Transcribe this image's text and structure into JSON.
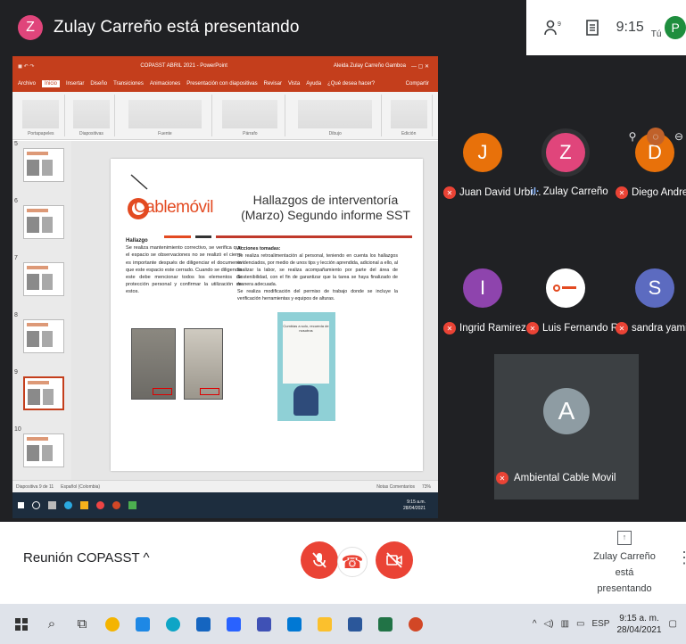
{
  "presenter": {
    "initial": "Z",
    "title": "Zulay Carreño está presentando"
  },
  "topright": {
    "time": "9:15",
    "you_label": "Tú",
    "user_initial": "P",
    "people_icon_count": "9"
  },
  "presentation": {
    "window_title": "COPASST ABRIL 2021 - PowerPoint",
    "window_user": "Aleida Zulay Carreño Gamboa",
    "ribbon_tabs": [
      "Archivo",
      "Inicio",
      "Insertar",
      "Diseño",
      "Transiciones",
      "Animaciones",
      "Presentación con diapositivas",
      "Revisar",
      "Vista",
      "Ayuda",
      "¿Qué desea hacer?"
    ],
    "ribbon_share": "Compartir",
    "ribbon_groups": [
      "Portapapeles",
      "Diapositivas",
      "Fuente",
      "Párrafo",
      "Dibujo",
      "Edición"
    ],
    "thumb_numbers": [
      "5",
      "6",
      "7",
      "8",
      "9",
      "10"
    ],
    "slide": {
      "logo": "Cablemóvil",
      "title": "Hallazgos de interventoría (Marzo) Segundo informe SST",
      "hallazgo_heading": "Hallazgo",
      "hallazgo_text": "Se realiza mantenimiento correctivo, se verifica que el espacio se observaciones no se realizó el cierre es importante después de diligenciar el documento que este espacio este cerrado. Cuando se diligencia este debe mencionar todos los elementos de protección personal y confirmar la utilización de estos.",
      "acciones_heading": "Acciones tomadas:",
      "acciones_text": "Se realiza retroalimentación al personal, teniendo en cuenta los hallazgos evidenciados, por medio de unos tips y lección aprendida, adicional a ello, al finalizar la labor, se realiza acompañamiento por parte del área de Sostenibilidad, con el fin de garantizar que la tarea se haya finalizado de manera adecuada.",
      "acciones_text2": "Se realiza modificación del permiso de trabajo donde se incluye la verificación herramientas y equipos de alturas.",
      "poster_title": "Cumbias a solo, recuerda de nosotros"
    },
    "status_left": "Diapositiva 9 de 11",
    "status_lang": "Español (Colombia)",
    "status_right": "Notas   Comentarios",
    "zoom": "73%",
    "inner_clock_time": "9:15 a.m.",
    "inner_clock_date": "28/04/2021"
  },
  "participants": [
    {
      "name": "Juan David Urbi...",
      "initial": "J",
      "color": "#e8710a",
      "muted": true
    },
    {
      "name": "Zulay Carreño",
      "initial": "Z",
      "color": "#e0457b",
      "muted": false
    },
    {
      "name": "Diego Andres A...",
      "initial": "D",
      "color": "#e8710a",
      "muted": true
    },
    {
      "name": "Ingrid Ramirez",
      "initial": "I",
      "color": "#8e44ad",
      "muted": true
    },
    {
      "name": "Luis Fernando R...",
      "initial": "",
      "color": "#ffffff",
      "muted": true
    },
    {
      "name": "sandra yamile c...",
      "initial": "S",
      "color": "#5c6bc0",
      "muted": true
    }
  ],
  "main_tile": {
    "name": "Ambiental Cable Movil",
    "initial": "A"
  },
  "bottom": {
    "meeting_name": "Reunión COPASST",
    "presenting_line1": "Zulay Carreño",
    "presenting_line2": "está presentando"
  },
  "taskbar": {
    "lang": "ESP",
    "time": "9:15 a. m.",
    "date": "28/04/2021"
  },
  "colors": {
    "meet_bg": "#202124",
    "ppt_red": "#c43e1c",
    "alert_red": "#ea4335"
  }
}
